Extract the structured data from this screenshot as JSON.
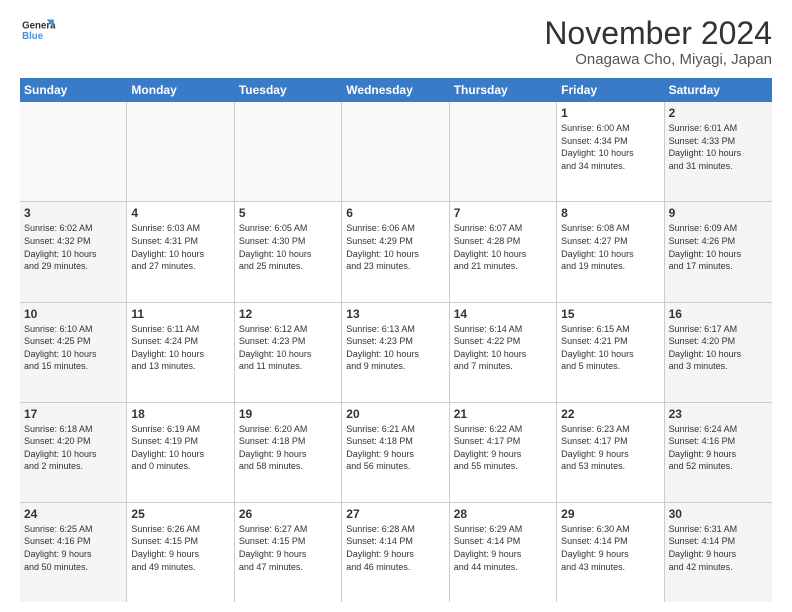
{
  "logo": {
    "line1": "General",
    "line2": "Blue"
  },
  "title": "November 2024",
  "location": "Onagawa Cho, Miyagi, Japan",
  "days_of_week": [
    "Sunday",
    "Monday",
    "Tuesday",
    "Wednesday",
    "Thursday",
    "Friday",
    "Saturday"
  ],
  "weeks": [
    [
      {
        "day": "",
        "info": ""
      },
      {
        "day": "",
        "info": ""
      },
      {
        "day": "",
        "info": ""
      },
      {
        "day": "",
        "info": ""
      },
      {
        "day": "",
        "info": ""
      },
      {
        "day": "1",
        "info": "Sunrise: 6:00 AM\nSunset: 4:34 PM\nDaylight: 10 hours\nand 34 minutes."
      },
      {
        "day": "2",
        "info": "Sunrise: 6:01 AM\nSunset: 4:33 PM\nDaylight: 10 hours\nand 31 minutes."
      }
    ],
    [
      {
        "day": "3",
        "info": "Sunrise: 6:02 AM\nSunset: 4:32 PM\nDaylight: 10 hours\nand 29 minutes."
      },
      {
        "day": "4",
        "info": "Sunrise: 6:03 AM\nSunset: 4:31 PM\nDaylight: 10 hours\nand 27 minutes."
      },
      {
        "day": "5",
        "info": "Sunrise: 6:05 AM\nSunset: 4:30 PM\nDaylight: 10 hours\nand 25 minutes."
      },
      {
        "day": "6",
        "info": "Sunrise: 6:06 AM\nSunset: 4:29 PM\nDaylight: 10 hours\nand 23 minutes."
      },
      {
        "day": "7",
        "info": "Sunrise: 6:07 AM\nSunset: 4:28 PM\nDaylight: 10 hours\nand 21 minutes."
      },
      {
        "day": "8",
        "info": "Sunrise: 6:08 AM\nSunset: 4:27 PM\nDaylight: 10 hours\nand 19 minutes."
      },
      {
        "day": "9",
        "info": "Sunrise: 6:09 AM\nSunset: 4:26 PM\nDaylight: 10 hours\nand 17 minutes."
      }
    ],
    [
      {
        "day": "10",
        "info": "Sunrise: 6:10 AM\nSunset: 4:25 PM\nDaylight: 10 hours\nand 15 minutes."
      },
      {
        "day": "11",
        "info": "Sunrise: 6:11 AM\nSunset: 4:24 PM\nDaylight: 10 hours\nand 13 minutes."
      },
      {
        "day": "12",
        "info": "Sunrise: 6:12 AM\nSunset: 4:23 PM\nDaylight: 10 hours\nand 11 minutes."
      },
      {
        "day": "13",
        "info": "Sunrise: 6:13 AM\nSunset: 4:23 PM\nDaylight: 10 hours\nand 9 minutes."
      },
      {
        "day": "14",
        "info": "Sunrise: 6:14 AM\nSunset: 4:22 PM\nDaylight: 10 hours\nand 7 minutes."
      },
      {
        "day": "15",
        "info": "Sunrise: 6:15 AM\nSunset: 4:21 PM\nDaylight: 10 hours\nand 5 minutes."
      },
      {
        "day": "16",
        "info": "Sunrise: 6:17 AM\nSunset: 4:20 PM\nDaylight: 10 hours\nand 3 minutes."
      }
    ],
    [
      {
        "day": "17",
        "info": "Sunrise: 6:18 AM\nSunset: 4:20 PM\nDaylight: 10 hours\nand 2 minutes."
      },
      {
        "day": "18",
        "info": "Sunrise: 6:19 AM\nSunset: 4:19 PM\nDaylight: 10 hours\nand 0 minutes."
      },
      {
        "day": "19",
        "info": "Sunrise: 6:20 AM\nSunset: 4:18 PM\nDaylight: 9 hours\nand 58 minutes."
      },
      {
        "day": "20",
        "info": "Sunrise: 6:21 AM\nSunset: 4:18 PM\nDaylight: 9 hours\nand 56 minutes."
      },
      {
        "day": "21",
        "info": "Sunrise: 6:22 AM\nSunset: 4:17 PM\nDaylight: 9 hours\nand 55 minutes."
      },
      {
        "day": "22",
        "info": "Sunrise: 6:23 AM\nSunset: 4:17 PM\nDaylight: 9 hours\nand 53 minutes."
      },
      {
        "day": "23",
        "info": "Sunrise: 6:24 AM\nSunset: 4:16 PM\nDaylight: 9 hours\nand 52 minutes."
      }
    ],
    [
      {
        "day": "24",
        "info": "Sunrise: 6:25 AM\nSunset: 4:16 PM\nDaylight: 9 hours\nand 50 minutes."
      },
      {
        "day": "25",
        "info": "Sunrise: 6:26 AM\nSunset: 4:15 PM\nDaylight: 9 hours\nand 49 minutes."
      },
      {
        "day": "26",
        "info": "Sunrise: 6:27 AM\nSunset: 4:15 PM\nDaylight: 9 hours\nand 47 minutes."
      },
      {
        "day": "27",
        "info": "Sunrise: 6:28 AM\nSunset: 4:14 PM\nDaylight: 9 hours\nand 46 minutes."
      },
      {
        "day": "28",
        "info": "Sunrise: 6:29 AM\nSunset: 4:14 PM\nDaylight: 9 hours\nand 44 minutes."
      },
      {
        "day": "29",
        "info": "Sunrise: 6:30 AM\nSunset: 4:14 PM\nDaylight: 9 hours\nand 43 minutes."
      },
      {
        "day": "30",
        "info": "Sunrise: 6:31 AM\nSunset: 4:14 PM\nDaylight: 9 hours\nand 42 minutes."
      }
    ]
  ]
}
